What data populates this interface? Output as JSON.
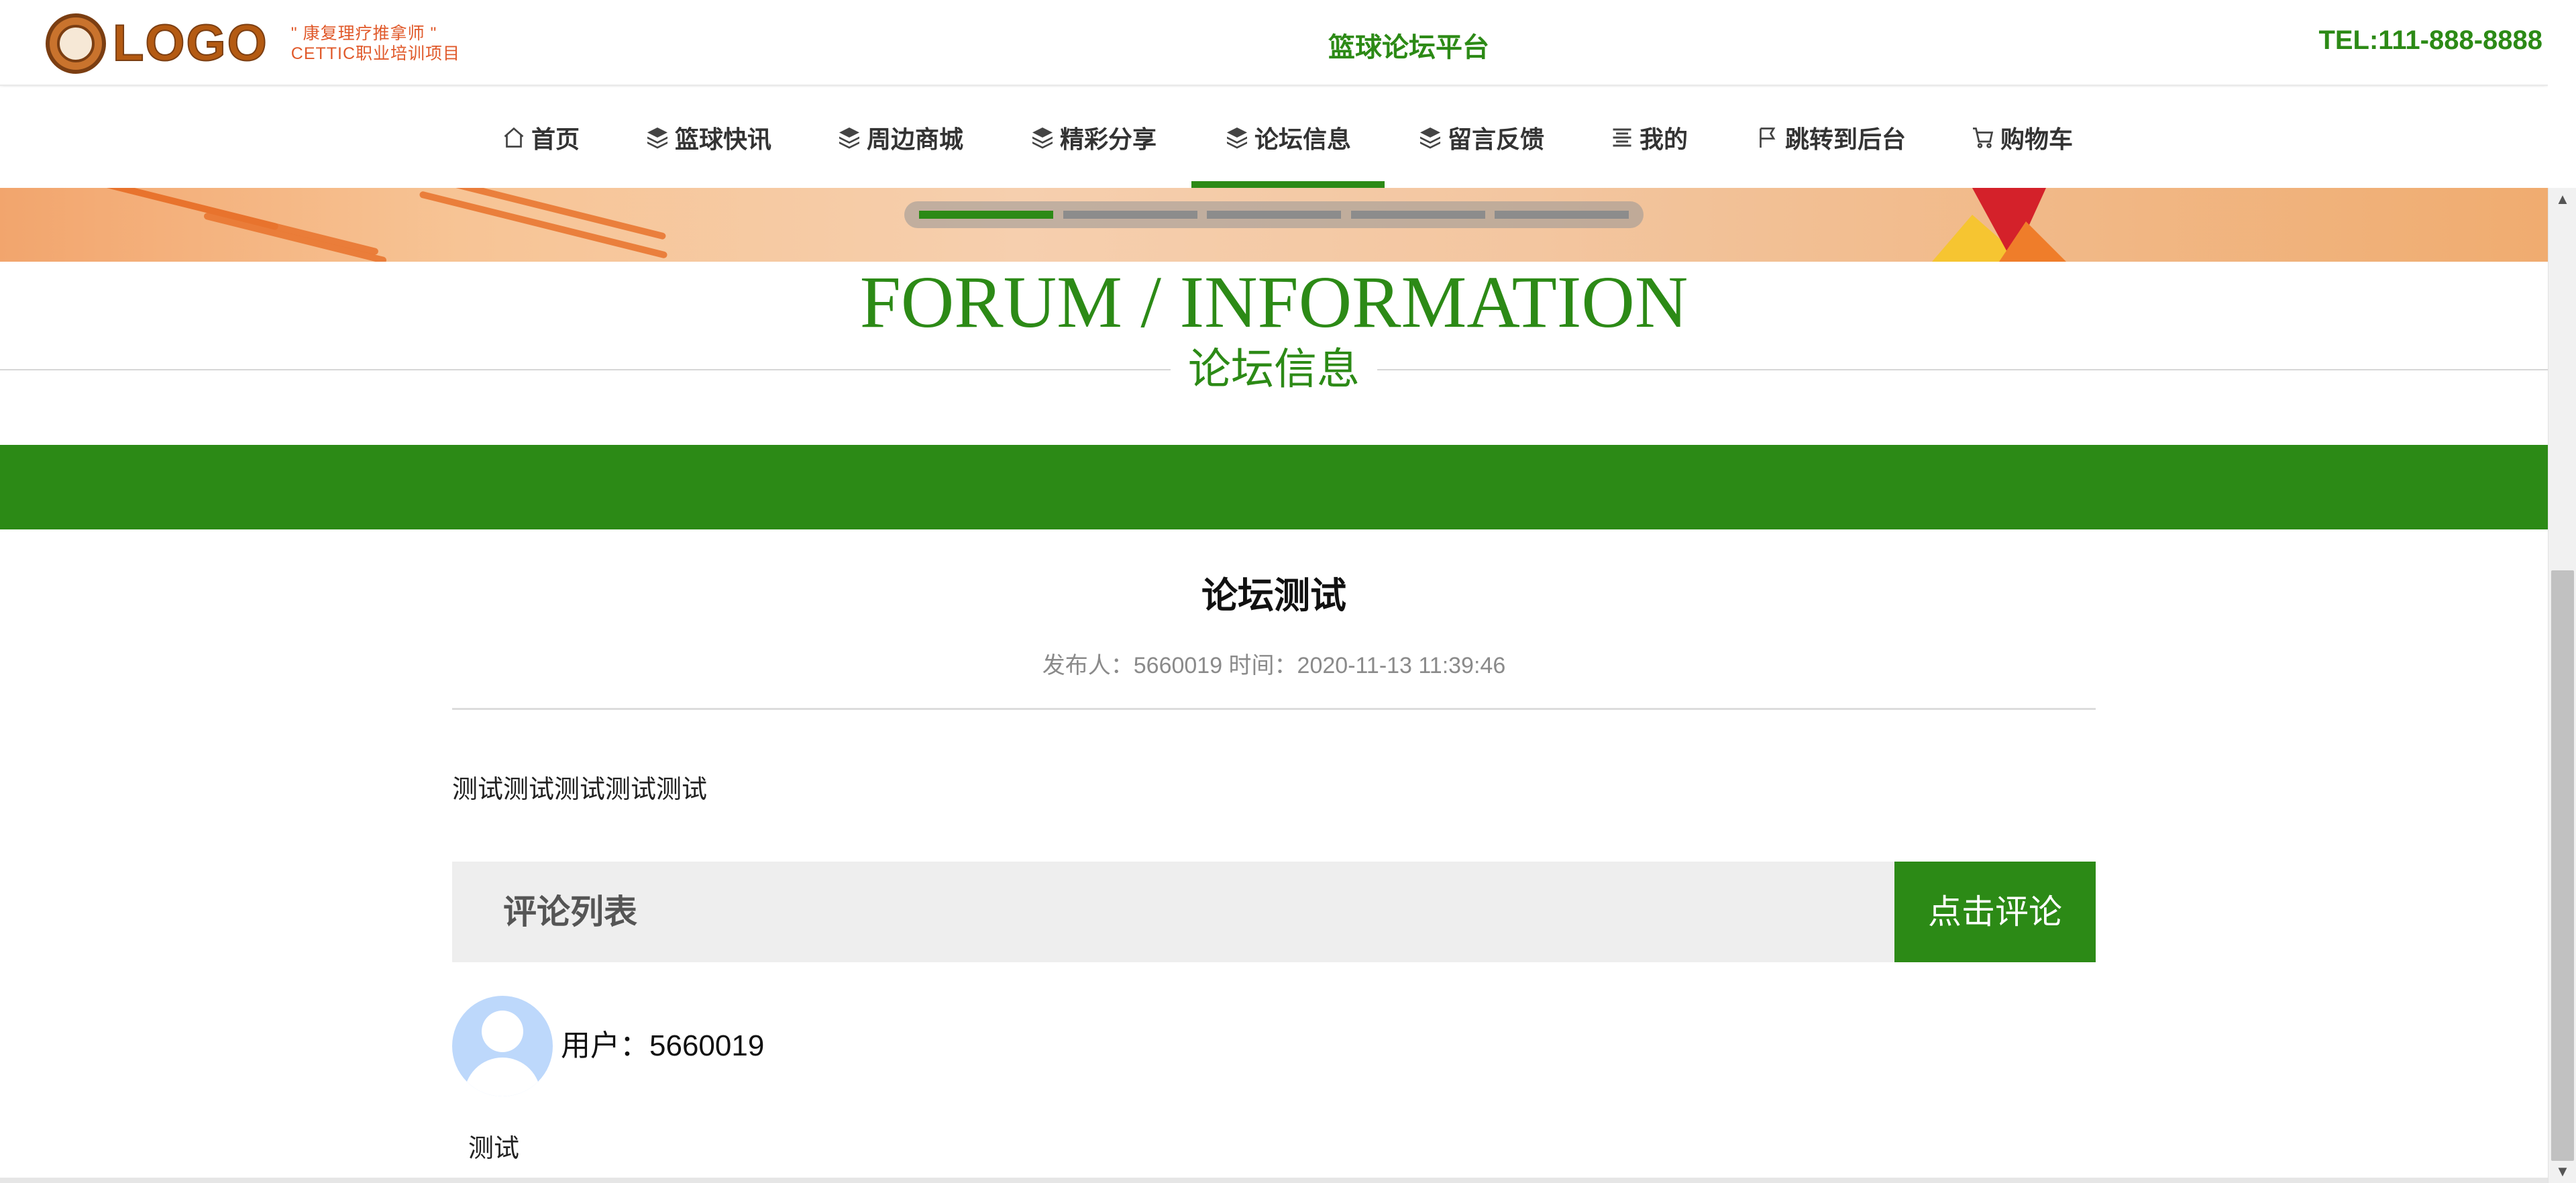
{
  "header": {
    "logo_text": "LOGO",
    "slogan_line1": "\" 康复理疗推拿师 \"",
    "slogan_line2": "CETTIC职业培训项目",
    "site_title": "篮球论坛平台",
    "tel": "TEL:111-888-8888"
  },
  "nav": {
    "items": [
      {
        "label": "首页",
        "icon": "home-icon"
      },
      {
        "label": "篮球快讯",
        "icon": "layers-icon"
      },
      {
        "label": "周边商城",
        "icon": "layers-icon"
      },
      {
        "label": "精彩分享",
        "icon": "layers-icon"
      },
      {
        "label": "论坛信息",
        "icon": "layers-icon",
        "active": true
      },
      {
        "label": "留言反馈",
        "icon": "layers-icon"
      },
      {
        "label": "我的",
        "icon": "list-icon"
      },
      {
        "label": "跳转到后台",
        "icon": "flag-icon"
      },
      {
        "label": "购物车",
        "icon": "cart-icon"
      }
    ]
  },
  "banner": {
    "slide_count": 5,
    "active_slide": 1
  },
  "section": {
    "title_en": "FORUM / INFORMATION",
    "title_cn": "论坛信息"
  },
  "article": {
    "title": "论坛测试",
    "meta": "发布人：5660019 时间：2020-11-13 11:39:46",
    "body": "测试测试测试测试测试"
  },
  "comments": {
    "header": "评论列表",
    "button_label": "点击评论",
    "items": [
      {
        "user": "用户：5660019",
        "text": "测试"
      }
    ]
  },
  "colors": {
    "accent": "#2c8a16",
    "header_text": "#2c8a16",
    "comment_bar_bg": "#eeeeee",
    "avatar_bg": "#bdd8fb"
  }
}
